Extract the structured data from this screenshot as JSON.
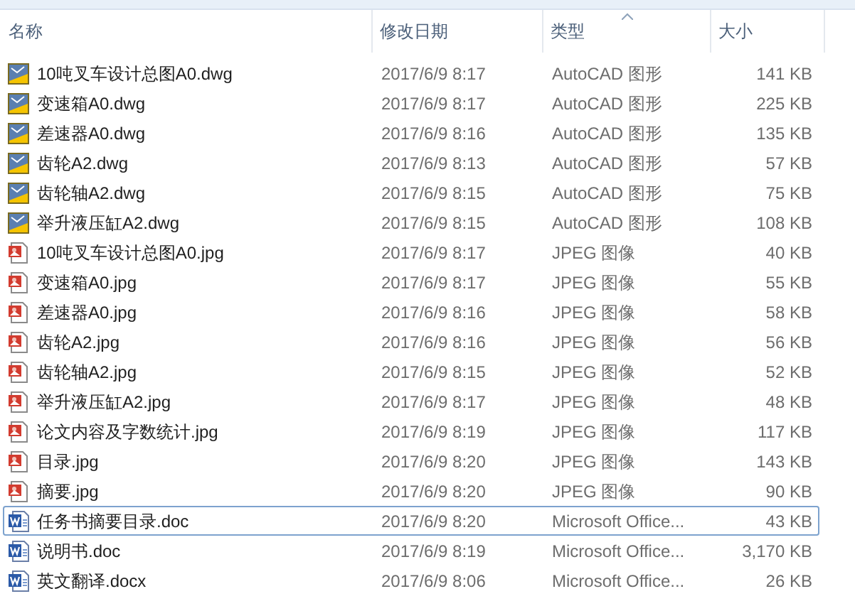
{
  "columns": [
    {
      "label": "名称",
      "sorted": false
    },
    {
      "label": "修改日期",
      "sorted": false
    },
    {
      "label": "类型",
      "sorted": true
    },
    {
      "label": "大小",
      "sorted": false
    }
  ],
  "files": [
    {
      "name": "10吨叉车设计总图A0.dwg",
      "kind": "dwg",
      "date": "2017/6/9 8:17",
      "type": "AutoCAD 图形",
      "size": "141 KB",
      "focused": false
    },
    {
      "name": "变速箱A0.dwg",
      "kind": "dwg",
      "date": "2017/6/9 8:17",
      "type": "AutoCAD 图形",
      "size": "225 KB",
      "focused": false
    },
    {
      "name": "差速器A0.dwg",
      "kind": "dwg",
      "date": "2017/6/9 8:16",
      "type": "AutoCAD 图形",
      "size": "135 KB",
      "focused": false
    },
    {
      "name": "齿轮A2.dwg",
      "kind": "dwg",
      "date": "2017/6/9 8:13",
      "type": "AutoCAD 图形",
      "size": "57 KB",
      "focused": false
    },
    {
      "name": "齿轮轴A2.dwg",
      "kind": "dwg",
      "date": "2017/6/9 8:15",
      "type": "AutoCAD 图形",
      "size": "75 KB",
      "focused": false
    },
    {
      "name": "举升液压缸A2.dwg",
      "kind": "dwg",
      "date": "2017/6/9 8:15",
      "type": "AutoCAD 图形",
      "size": "108 KB",
      "focused": false
    },
    {
      "name": "10吨叉车设计总图A0.jpg",
      "kind": "jpg",
      "date": "2017/6/9 8:17",
      "type": "JPEG 图像",
      "size": "40 KB",
      "focused": false
    },
    {
      "name": "变速箱A0.jpg",
      "kind": "jpg",
      "date": "2017/6/9 8:17",
      "type": "JPEG 图像",
      "size": "55 KB",
      "focused": false
    },
    {
      "name": "差速器A0.jpg",
      "kind": "jpg",
      "date": "2017/6/9 8:16",
      "type": "JPEG 图像",
      "size": "58 KB",
      "focused": false
    },
    {
      "name": "齿轮A2.jpg",
      "kind": "jpg",
      "date": "2017/6/9 8:16",
      "type": "JPEG 图像",
      "size": "56 KB",
      "focused": false
    },
    {
      "name": "齿轮轴A2.jpg",
      "kind": "jpg",
      "date": "2017/6/9 8:15",
      "type": "JPEG 图像",
      "size": "52 KB",
      "focused": false
    },
    {
      "name": "举升液压缸A2.jpg",
      "kind": "jpg",
      "date": "2017/6/9 8:17",
      "type": "JPEG 图像",
      "size": "48 KB",
      "focused": false
    },
    {
      "name": "论文内容及字数统计.jpg",
      "kind": "jpg",
      "date": "2017/6/9 8:19",
      "type": "JPEG 图像",
      "size": "117 KB",
      "focused": false
    },
    {
      "name": "目录.jpg",
      "kind": "jpg",
      "date": "2017/6/9 8:20",
      "type": "JPEG 图像",
      "size": "143 KB",
      "focused": false
    },
    {
      "name": "摘要.jpg",
      "kind": "jpg",
      "date": "2017/6/9 8:20",
      "type": "JPEG 图像",
      "size": "90 KB",
      "focused": false
    },
    {
      "name": "任务书摘要目录.doc",
      "kind": "doc",
      "date": "2017/6/9 8:20",
      "type": "Microsoft Office...",
      "size": "43 KB",
      "focused": true
    },
    {
      "name": "说明书.doc",
      "kind": "doc",
      "date": "2017/6/9 8:19",
      "type": "Microsoft Office...",
      "size": "3,170 KB",
      "focused": false
    },
    {
      "name": "英文翻译.docx",
      "kind": "doc",
      "date": "2017/6/9 8:06",
      "type": "Microsoft Office...",
      "size": "26 KB",
      "focused": false
    }
  ]
}
